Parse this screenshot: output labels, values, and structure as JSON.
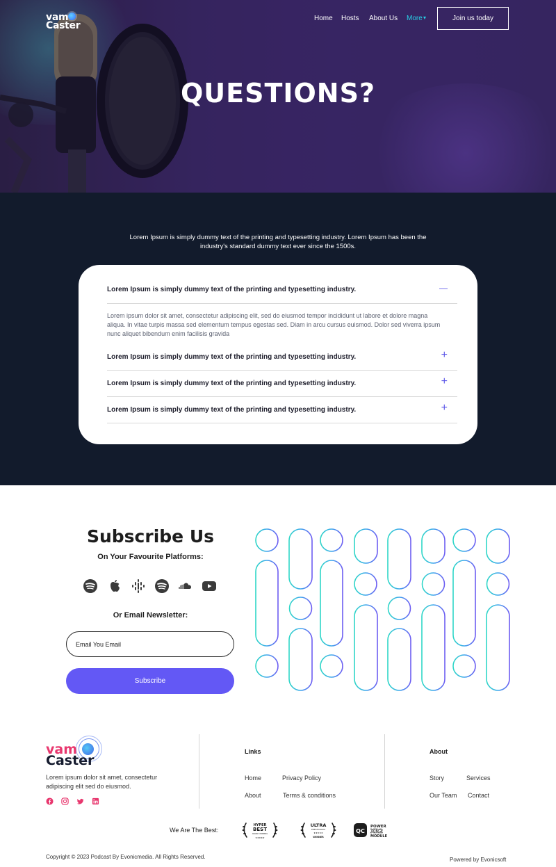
{
  "brand": {
    "line1": "vam",
    "line2": "Caster"
  },
  "nav": {
    "items": [
      "Home",
      "Hosts",
      "About Us"
    ],
    "more_label": "More",
    "cta_label": "Join us today"
  },
  "hero": {
    "title": "QUESTIONS?"
  },
  "faq": {
    "intro": "Lorem Ipsum is simply dummy text of the printing and typesetting industry. Lorem Ipsum has been the industry's standard dummy text ever since the 1500s.",
    "questions": [
      {
        "title": "Lorem Ipsum is simply dummy text of the printing and typesetting industry.",
        "icon": "—",
        "expanded": true
      },
      {
        "title": "Lorem Ipsum is simply dummy text of the printing and typesetting industry.",
        "icon": "+",
        "expanded": false
      },
      {
        "title": "Lorem Ipsum is simply dummy text of the printing and typesetting industry.",
        "icon": "+",
        "expanded": false
      },
      {
        "title": "Lorem Ipsum is simply dummy text of the printing and typesetting industry.",
        "icon": "+",
        "expanded": false
      }
    ],
    "answer": "Lorem ipsum dolor sit amet, consectetur adipiscing elit, sed do eiusmod tempor incididunt ut labore et dolore magna aliqua. In vitae turpis massa sed elementum tempus egestas sed. Diam in arcu cursus euismod. Dolor sed viverra ipsum nunc aliquet bibendum enim facilisis gravida"
  },
  "subscribe": {
    "title": "Subscribe Us",
    "platforms_label": "On Your Favourite Platforms:",
    "platform_icons": [
      "spotify-icon",
      "apple-podcasts-icon",
      "google-podcasts-icon",
      "spotify-icon",
      "soundcloud-icon",
      "youtube-icon"
    ],
    "newsletter_label": "Or Email Newsletter:",
    "email_placeholder": "Email You Email",
    "button_label": "Subscribe"
  },
  "footer": {
    "brand": {
      "line1": "vam",
      "line2": "Caster"
    },
    "description": "Lorem ipsum dolor sit amet, consectetur adipiscing elit  sed do eiusmod.",
    "social_icons": [
      "facebook-icon",
      "instagram-icon",
      "twitter-icon",
      "linkedin-icon"
    ],
    "links_heading": "Links",
    "links": [
      "Home",
      "Privacy Policy",
      "About",
      "Terms & conditions"
    ],
    "about_heading": "About",
    "about_links": [
      "Story",
      "Services",
      "Our Team",
      "Contact"
    ],
    "best_label": "We Are The Best:",
    "awards": [
      {
        "line1": "HYPER",
        "line2": "BEST",
        "line3": "AWARD WINNING"
      },
      {
        "line1": "ULTRA",
        "line2": "PRESTIGIOUS",
        "line3": "WINNER"
      },
      {
        "badge": "QC",
        "line1": "POWER",
        "line2": "XR2",
        "line3": "MODULE"
      }
    ],
    "copyright": "Copyright © 2023 Podcast By Evonicmedia. All Rights Reserved.",
    "powered": "Powered by Evonicsoft"
  },
  "colors": {
    "accent": "#6358f5",
    "nav_active": "#28d2e8",
    "faq_bg": "#121b2c",
    "brand_pink": "#e8376e"
  }
}
